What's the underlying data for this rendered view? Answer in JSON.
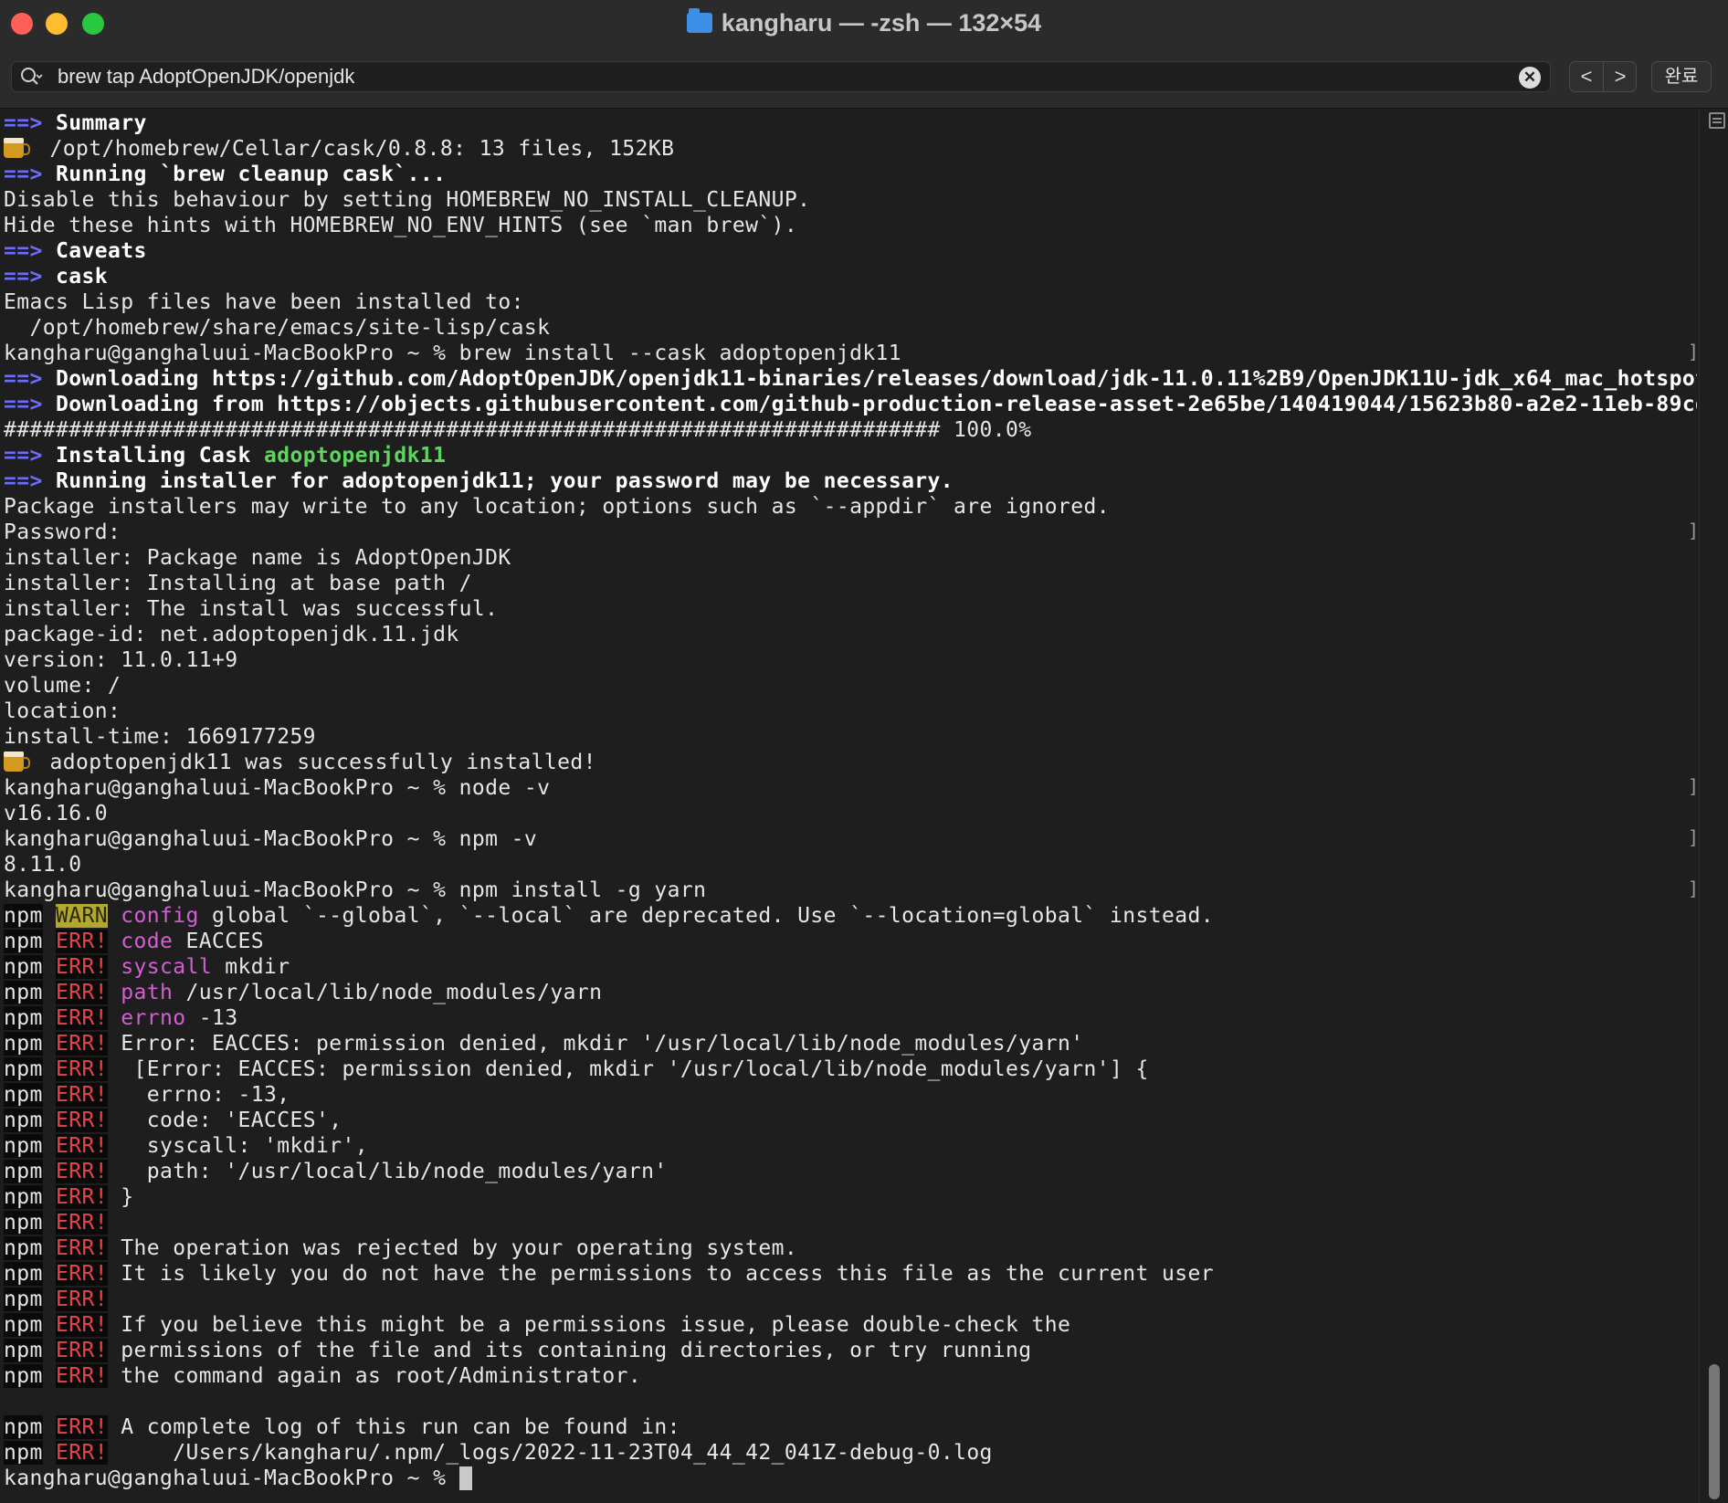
{
  "window": {
    "title": "kangharu — -zsh — 132×54"
  },
  "find": {
    "query": "brew tap AdoptOpenJDK/openjdk",
    "prev_label": "<",
    "next_label": ">",
    "done_label": "완료"
  },
  "terminal": {
    "lines": [
      "==> Summary",
      "/opt/homebrew/Cellar/cask/0.8.8: 13 files, 152KB",
      "==> Running `brew cleanup cask`...",
      "Disable this behaviour by setting HOMEBREW_NO_INSTALL_CLEANUP.",
      "Hide these hints with HOMEBREW_NO_ENV_HINTS (see `man brew`).",
      "==> Caveats",
      "==> cask",
      "Emacs Lisp files have been installed to:",
      "  /opt/homebrew/share/emacs/site-lisp/cask",
      "kangharu@ganghaluui-MacBookPro ~ % brew install --cask adoptopenjdk11",
      "==> Downloading https://github.com/AdoptOpenJDK/openjdk11-binaries/releases/download/jdk-11.0.11%2B9/OpenJDK11U-jdk_x64_mac_hotspot_",
      "==> Downloading from https://objects.githubusercontent.com/github-production-release-asset-2e65be/140419044/15623b80-a2e2-11eb-89cd-",
      "######################################################################## 100.0%",
      "==> Installing Cask adoptopenjdk11",
      "==> Running installer for adoptopenjdk11; your password may be necessary.",
      "Package installers may write to any location; options such as `--appdir` are ignored.",
      "Password:",
      "installer: Package name is AdoptOpenJDK",
      "installer: Installing at base path /",
      "installer: The install was successful.",
      "package-id: net.adoptopenjdk.11.jdk",
      "version: 11.0.11+9",
      "volume: /",
      "location:",
      "install-time: 1669177259",
      "adoptopenjdk11 was successfully installed!",
      "kangharu@ganghaluui-MacBookPro ~ % node -v",
      "v16.16.0",
      "kangharu@ganghaluui-MacBookPro ~ % npm -v",
      "8.11.0",
      "kangharu@ganghaluui-MacBookPro ~ % npm install -g yarn",
      "npm WARN config global `--global`, `--local` are deprecated. Use `--location=global` instead.",
      "npm ERR! code EACCES",
      "npm ERR! syscall mkdir",
      "npm ERR! path /usr/local/lib/node_modules/yarn",
      "npm ERR! errno -13",
      "npm ERR! Error: EACCES: permission denied, mkdir '/usr/local/lib/node_modules/yarn'",
      "npm ERR!  [Error: EACCES: permission denied, mkdir '/usr/local/lib/node_modules/yarn'] {",
      "npm ERR!   errno: -13,",
      "npm ERR!   code: 'EACCES',",
      "npm ERR!   syscall: 'mkdir',",
      "npm ERR!   path: '/usr/local/lib/node_modules/yarn'",
      "npm ERR! }",
      "npm ERR!",
      "npm ERR! The operation was rejected by your operating system.",
      "npm ERR! It is likely you do not have the permissions to access this file as the current user",
      "npm ERR!",
      "npm ERR! If you believe this might be a permissions issue, please double-check the",
      "npm ERR! permissions of the file and its containing directories, or try running",
      "npm ERR! the command again as root/Administrator.",
      "",
      "npm ERR! A complete log of this run can be found in:",
      "npm ERR!     /Users/kangharu/.npm/_logs/2022-11-23T04_44_42_041Z-debug-0.log",
      "kangharu@ganghaluui-MacBookPro ~ % "
    ]
  },
  "colors": {
    "arrow": "#6c6cff",
    "cask_name": "#5fd45f",
    "warn_bg": "#b3a631",
    "err": "#e8434a",
    "npm_key": "#d45fd4",
    "background": "#1e1e1e"
  }
}
